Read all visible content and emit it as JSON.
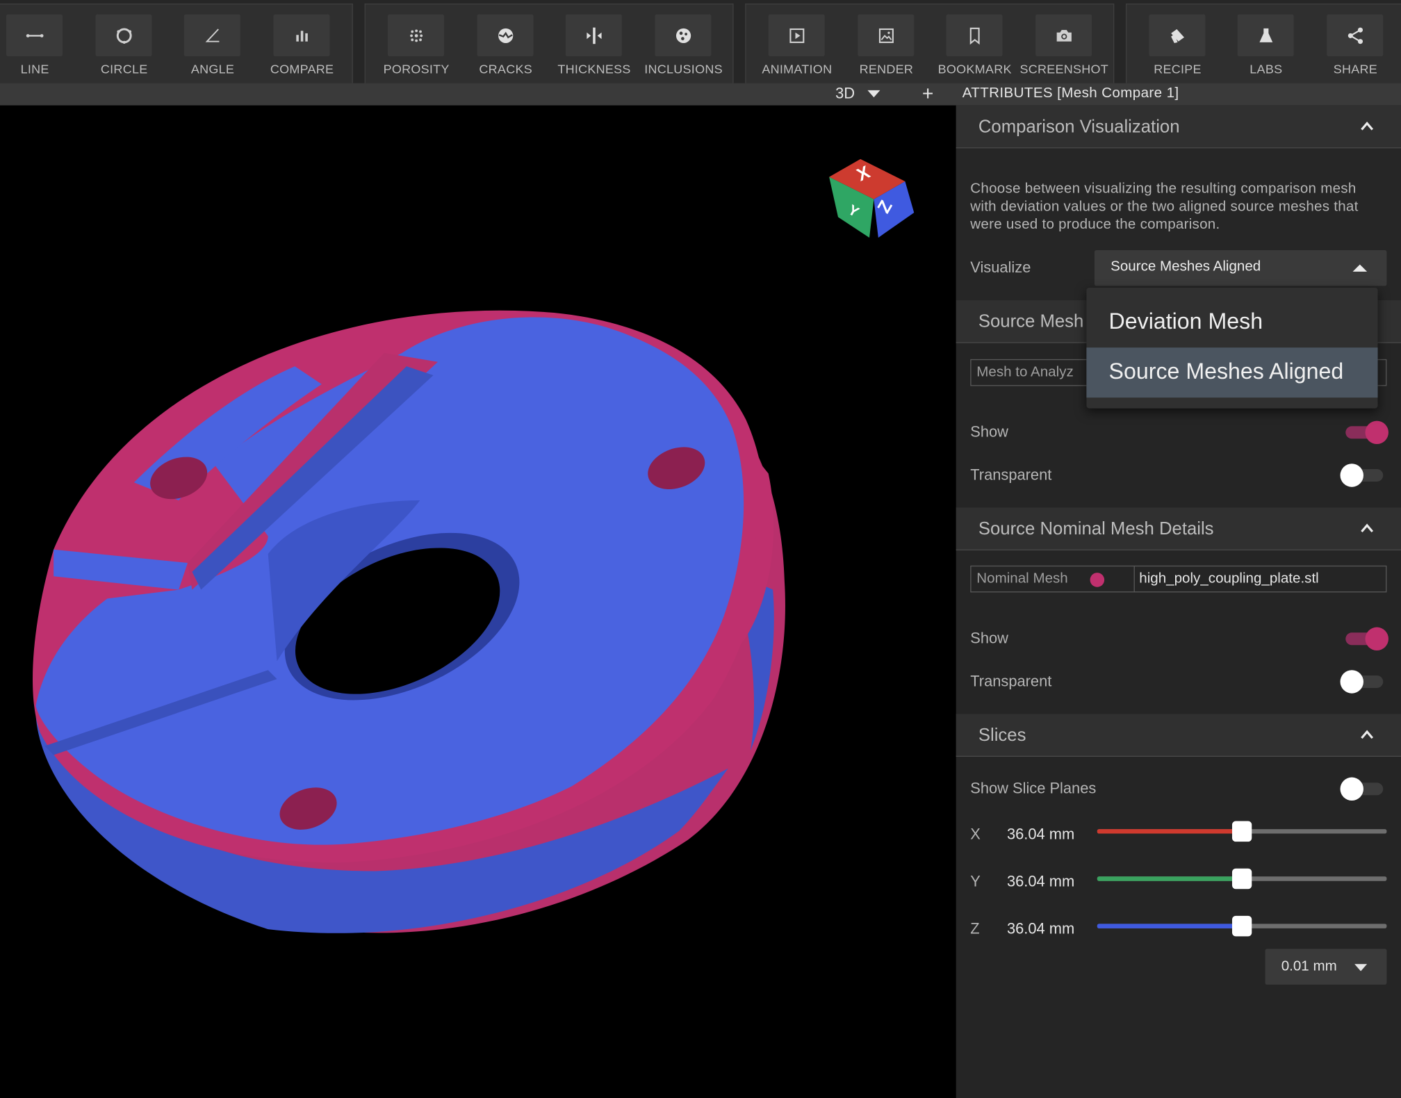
{
  "toolbar": {
    "groups": [
      {
        "tools": [
          {
            "label": "LINE",
            "icon": "line-icon"
          },
          {
            "label": "CIRCLE",
            "icon": "circle-icon"
          },
          {
            "label": "ANGLE",
            "icon": "angle-icon"
          },
          {
            "label": "COMPARE",
            "icon": "compare-icon"
          }
        ]
      },
      {
        "tools": [
          {
            "label": "POROSITY",
            "icon": "porosity-icon"
          },
          {
            "label": "CRACKS",
            "icon": "cracks-icon"
          },
          {
            "label": "THICKNESS",
            "icon": "thickness-icon"
          },
          {
            "label": "INCLUSIONS",
            "icon": "inclusions-icon"
          }
        ]
      },
      {
        "tools": [
          {
            "label": "ANIMATION",
            "icon": "animation-icon"
          },
          {
            "label": "RENDER",
            "icon": "render-icon"
          },
          {
            "label": "BOOKMARK",
            "icon": "bookmark-icon"
          },
          {
            "label": "SCREENSHOT",
            "icon": "camera-icon"
          }
        ]
      },
      {
        "tools": [
          {
            "label": "RECIPE",
            "icon": "recipe-icon"
          },
          {
            "label": "LABS",
            "icon": "flask-icon"
          },
          {
            "label": "SHARE",
            "icon": "share-icon"
          }
        ]
      }
    ]
  },
  "subbar": {
    "view_mode": "3D",
    "attributes_title": "ATTRIBUTES [Mesh Compare 1]"
  },
  "viewport": {
    "cube_labels": {
      "x": "X",
      "y": "Y",
      "z": "Z"
    },
    "colors": {
      "nominal": "#c0306e",
      "analyzed": "#4a63e0",
      "background": "#000000"
    }
  },
  "panel": {
    "comparison": {
      "title": "Comparison Visualization",
      "description": "Choose between visualizing the resulting comparison mesh with deviation values or the two aligned source meshes that were used to produce the comparison.",
      "visualize_label": "Visualize",
      "visualize_value": "Source Meshes Aligned"
    },
    "source_mesh": {
      "title": "Source Mesh",
      "field_label": "Mesh to Analyz",
      "show_label": "Show",
      "show": true,
      "transparent_label": "Transparent",
      "transparent": false
    },
    "nominal": {
      "title": "Source Nominal Mesh Details",
      "field_label": "Nominal Mesh",
      "field_value": "high_poly_coupling_plate.stl",
      "color": "#c0306e",
      "show_label": "Show",
      "show": true,
      "transparent_label": "Transparent",
      "transparent": false
    },
    "slices": {
      "title": "Slices",
      "show_planes_label": "Show Slice Planes",
      "show_planes": false,
      "axes": [
        {
          "axis": "X",
          "value": "36.04 mm",
          "fraction": 0.5,
          "color": "#d03a2e"
        },
        {
          "axis": "Y",
          "value": "36.04 mm",
          "fraction": 0.5,
          "color": "#3aa35f"
        },
        {
          "axis": "Z",
          "value": "36.04 mm",
          "fraction": 0.5,
          "color": "#3f5ae0"
        }
      ],
      "step": "0.01 mm"
    }
  },
  "dropdown": {
    "options": [
      "Deviation Mesh",
      "Source Meshes Aligned"
    ],
    "selected": "Source Meshes Aligned"
  }
}
